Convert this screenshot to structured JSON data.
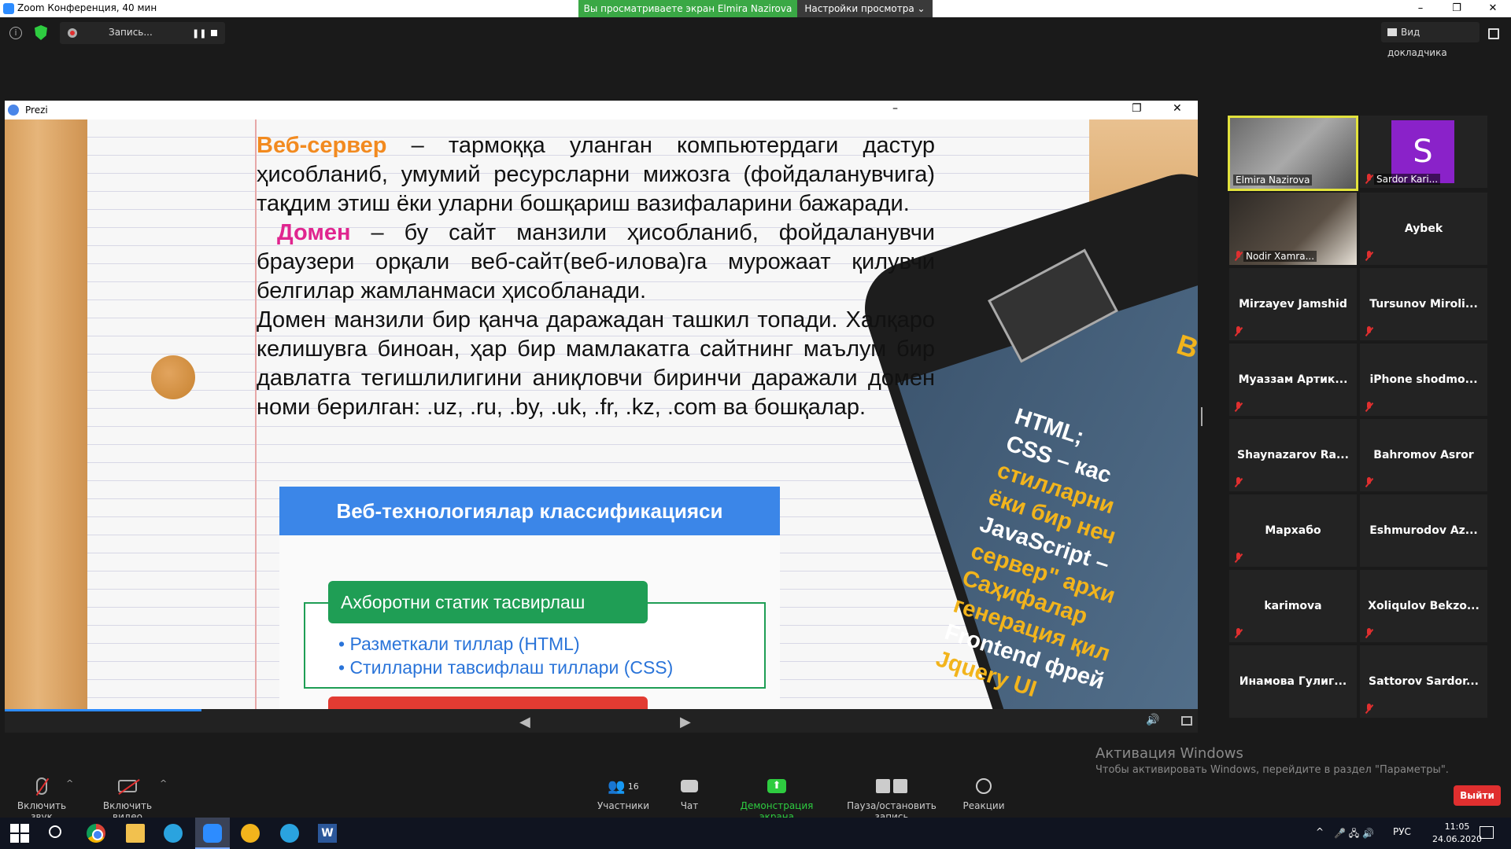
{
  "window": {
    "title": "Zoom Конференция, 40 мин",
    "share_banner": "Вы просматриваете экран Elmira Nazirova",
    "view_options": "Настройки просмотра",
    "controls": [
      "–",
      "❐",
      "✕"
    ]
  },
  "toolstrip": {
    "info_icon": "i",
    "recording_label": "Запись...",
    "pause_glyph": "❚❚",
    "speaker_view": "Вид докладчика"
  },
  "shared_window": {
    "title": "Prezi",
    "controls": [
      "–",
      "❐",
      "✕"
    ]
  },
  "slide": {
    "term1": "Веб-сервер",
    "text1": " – тармоққа уланган компьютердаги дастур ҳисобланиб, умумий ресурсларни мижозга (фойдаланувчига) тақдим этиш ёки уларни бошқариш вазифаларини бажаради.",
    "term2": "Домен",
    "text2": " – бу сайт манзили ҳисобланиб, фойдаланувчи браузери орқали веб-сайт(веб-илова)га мурожаат қилувчи белгилар жамланмаси ҳисобланади.",
    "text3": "Домен манзили бир қанча даражадан ташкил топади. Халқаро келишувга биноан, ҳар бир мамлакатга сайтнинг маълум бир давлатга тегишлилигини аниқловчи биринчи даражали домен номи берилган: .uz, .ru, .by, .uk, .fr, .kz, .com ва бошқалар.",
    "diagram_title": "Веб-технологиялар классификацияси",
    "diagram_group": "Ахборотни статик тасвирлаш",
    "diagram_items": [
      "• Разметкали тиллар (HTML)",
      "• Стилларни тавсифлаш тиллари (CSS)"
    ],
    "phone_b": "B",
    "phone_lines": [
      {
        "text": "HTML;",
        "color": "white"
      },
      {
        "text": "CSS – кас",
        "color": "mixed"
      },
      {
        "text": "стилларни",
        "color": "yellow"
      },
      {
        "text": "ёки бир неч",
        "color": "yellow"
      },
      {
        "text": "JavaScript –",
        "color": "mixed"
      },
      {
        "text": "сервер\" архи",
        "color": "yellow"
      },
      {
        "text": "Саҳифалар",
        "color": "yellow"
      },
      {
        "text": "генерация қил",
        "color": "yellow"
      },
      {
        "text": "Frontend фрей",
        "color": "white"
      },
      {
        "text": "Jquery UI",
        "color": "yellow"
      }
    ]
  },
  "slide_nav": {
    "prev_icon": "◀",
    "next_icon": "▶",
    "sound_icon": "🔊"
  },
  "participants": [
    {
      "name": "Elmira Nazirova",
      "kind": "video",
      "active": true
    },
    {
      "name": "Sardor Kari...",
      "kind": "avatar",
      "initial": "S",
      "muted": true
    },
    {
      "name": "Nodir Xamra...",
      "kind": "video",
      "muted": true
    },
    {
      "name": "Aybek",
      "kind": "name",
      "muted": true
    },
    {
      "name": "Mirzayev Jamshid",
      "kind": "name",
      "muted": true
    },
    {
      "name": "Tursunov Miroli...",
      "kind": "name",
      "muted": true
    },
    {
      "name": "Муаззам Артик...",
      "kind": "name",
      "muted": true
    },
    {
      "name": "iPhone shodmo...",
      "kind": "name",
      "muted": true
    },
    {
      "name": "Shaynazarov Ra...",
      "kind": "name",
      "muted": true
    },
    {
      "name": "Bahromov Asror",
      "kind": "name",
      "muted": true
    },
    {
      "name": "Мархабо",
      "kind": "name",
      "muted": true
    },
    {
      "name": "Eshmurodov Az...",
      "kind": "name",
      "muted": false
    },
    {
      "name": "karimova",
      "kind": "name",
      "muted": true
    },
    {
      "name": "Xoliqulov Bekzo...",
      "kind": "name",
      "muted": true
    },
    {
      "name": "Инамова Гулиг...",
      "kind": "name",
      "muted": false
    },
    {
      "name": "Sattorov Sardor...",
      "kind": "name",
      "muted": true
    }
  ],
  "watermark": {
    "title": "Активация Windows",
    "subtitle": "Чтобы активировать Windows, перейдите в раздел \"Параметры\"."
  },
  "toolbar": {
    "audio_label": "Включить звук",
    "video_label": "Включить видео",
    "caret": "^",
    "participants_icon": "👥",
    "participants_count": "16",
    "participants_label": "Участники",
    "chat_label": "Чат",
    "share_icon": "⬆",
    "share_label": "Демонстрация экрана",
    "record_label": "Пауза/остановить запись",
    "reactions_label": "Реакции",
    "leave_label": "Выйти"
  },
  "taskbar": {
    "word_letter": "W",
    "tray_arrow": "^",
    "tray_icons": "🎤 🖧 🔊",
    "language": "РУС",
    "time": "11:05",
    "date": "24.06.2020"
  },
  "colors": {
    "zoom_blue": "#2d8cff",
    "share_green": "#3aa845",
    "leave_red": "#e02f2f",
    "active_speaker": "#e2e23c"
  }
}
